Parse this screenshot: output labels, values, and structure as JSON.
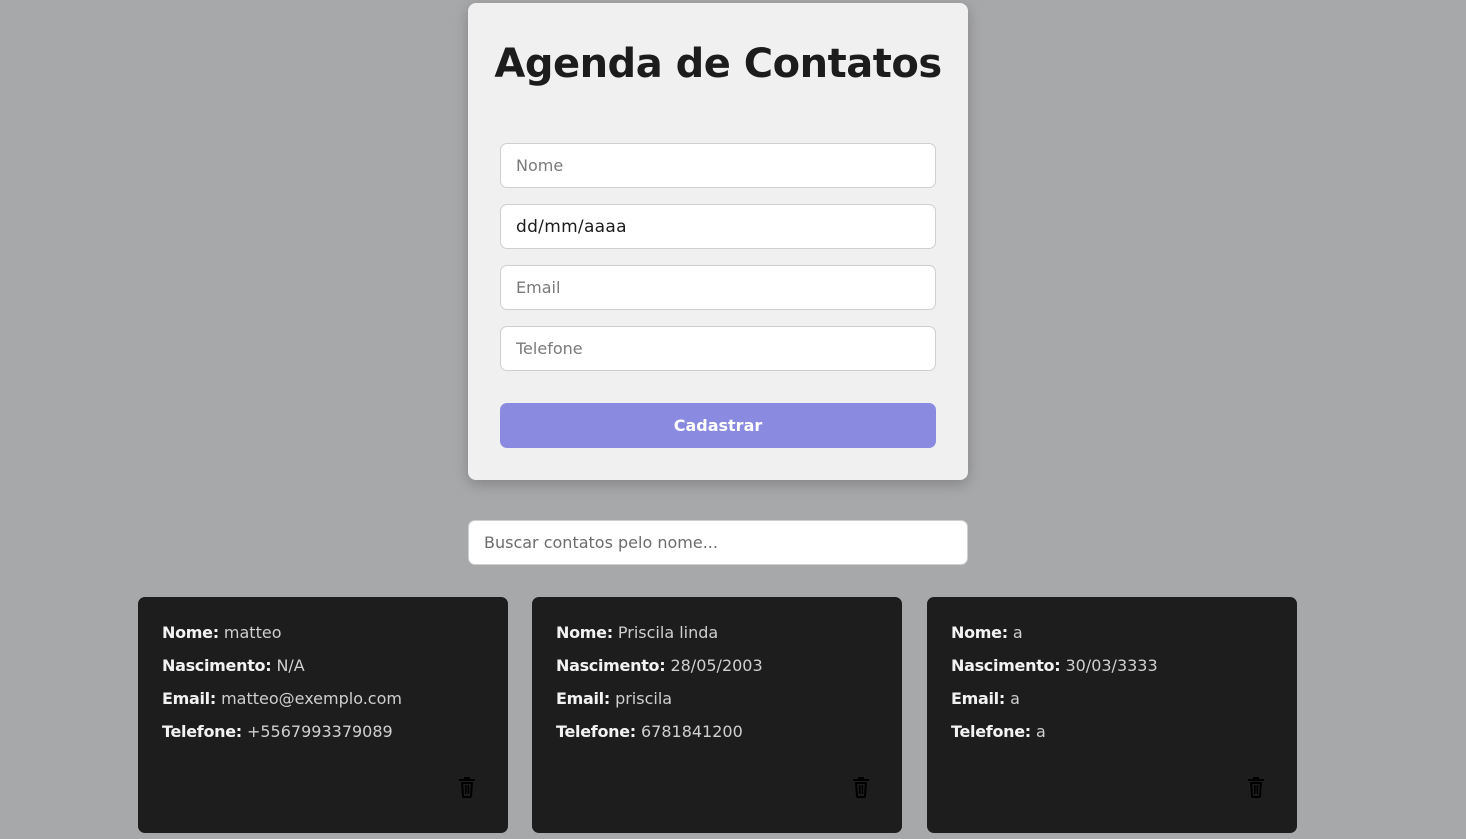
{
  "form": {
    "title": "Agenda de Contatos",
    "name_placeholder": "Nome",
    "birth_value": "dd/mm/aaaa",
    "email_placeholder": "Email",
    "phone_placeholder": "Telefone",
    "submit_label": "Cadastrar"
  },
  "search": {
    "placeholder": "Buscar contatos pelo nome..."
  },
  "labels": {
    "name": "Nome:",
    "birth": "Nascimento:",
    "email": "Email:",
    "phone": "Telefone:"
  },
  "contacts": [
    {
      "name": "matteo",
      "birth": "N/A",
      "email": "matteo@exemplo.com",
      "phone": "+5567993379089"
    },
    {
      "name": "Priscila linda",
      "birth": "28/05/2003",
      "email": "priscila",
      "phone": "6781841200"
    },
    {
      "name": "a",
      "birth": "30/03/3333",
      "email": "a",
      "phone": "a"
    }
  ],
  "colors": {
    "background": "#a7a8aa",
    "card": "#f0f0f0",
    "accent_button": "#8a8be0",
    "contact_card": "#1d1d1e"
  },
  "icons": {
    "delete": "trash-icon"
  }
}
